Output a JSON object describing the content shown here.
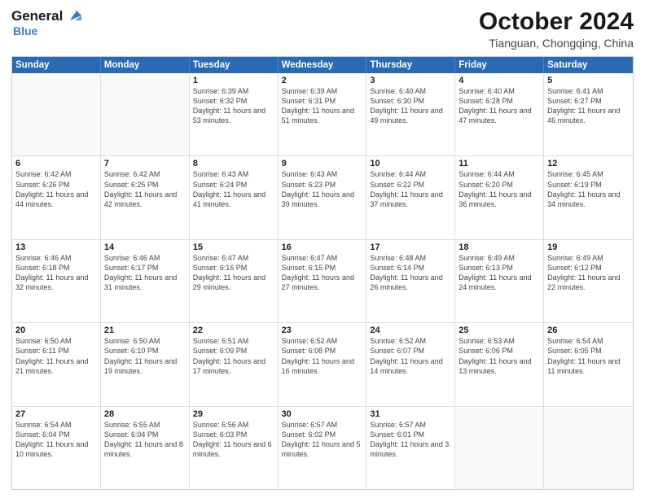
{
  "header": {
    "logo_general": "General",
    "logo_blue": "Blue",
    "main_title": "October 2024",
    "sub_title": "Tianguan, Chongqing, China"
  },
  "weekdays": [
    "Sunday",
    "Monday",
    "Tuesday",
    "Wednesday",
    "Thursday",
    "Friday",
    "Saturday"
  ],
  "weeks": [
    [
      {
        "day": "",
        "sunrise": "",
        "sunset": "",
        "daylight": "",
        "empty": true
      },
      {
        "day": "",
        "sunrise": "",
        "sunset": "",
        "daylight": "",
        "empty": true
      },
      {
        "day": "1",
        "sunrise": "Sunrise: 6:39 AM",
        "sunset": "Sunset: 6:32 PM",
        "daylight": "Daylight: 11 hours and 53 minutes.",
        "empty": false
      },
      {
        "day": "2",
        "sunrise": "Sunrise: 6:39 AM",
        "sunset": "Sunset: 6:31 PM",
        "daylight": "Daylight: 11 hours and 51 minutes.",
        "empty": false
      },
      {
        "day": "3",
        "sunrise": "Sunrise: 6:40 AM",
        "sunset": "Sunset: 6:30 PM",
        "daylight": "Daylight: 11 hours and 49 minutes.",
        "empty": false
      },
      {
        "day": "4",
        "sunrise": "Sunrise: 6:40 AM",
        "sunset": "Sunset: 6:28 PM",
        "daylight": "Daylight: 11 hours and 47 minutes.",
        "empty": false
      },
      {
        "day": "5",
        "sunrise": "Sunrise: 6:41 AM",
        "sunset": "Sunset: 6:27 PM",
        "daylight": "Daylight: 11 hours and 46 minutes.",
        "empty": false
      }
    ],
    [
      {
        "day": "6",
        "sunrise": "Sunrise: 6:42 AM",
        "sunset": "Sunset: 6:26 PM",
        "daylight": "Daylight: 11 hours and 44 minutes.",
        "empty": false
      },
      {
        "day": "7",
        "sunrise": "Sunrise: 6:42 AM",
        "sunset": "Sunset: 6:25 PM",
        "daylight": "Daylight: 11 hours and 42 minutes.",
        "empty": false
      },
      {
        "day": "8",
        "sunrise": "Sunrise: 6:43 AM",
        "sunset": "Sunset: 6:24 PM",
        "daylight": "Daylight: 11 hours and 41 minutes.",
        "empty": false
      },
      {
        "day": "9",
        "sunrise": "Sunrise: 6:43 AM",
        "sunset": "Sunset: 6:23 PM",
        "daylight": "Daylight: 11 hours and 39 minutes.",
        "empty": false
      },
      {
        "day": "10",
        "sunrise": "Sunrise: 6:44 AM",
        "sunset": "Sunset: 6:22 PM",
        "daylight": "Daylight: 11 hours and 37 minutes.",
        "empty": false
      },
      {
        "day": "11",
        "sunrise": "Sunrise: 6:44 AM",
        "sunset": "Sunset: 6:20 PM",
        "daylight": "Daylight: 11 hours and 36 minutes.",
        "empty": false
      },
      {
        "day": "12",
        "sunrise": "Sunrise: 6:45 AM",
        "sunset": "Sunset: 6:19 PM",
        "daylight": "Daylight: 11 hours and 34 minutes.",
        "empty": false
      }
    ],
    [
      {
        "day": "13",
        "sunrise": "Sunrise: 6:46 AM",
        "sunset": "Sunset: 6:18 PM",
        "daylight": "Daylight: 11 hours and 32 minutes.",
        "empty": false
      },
      {
        "day": "14",
        "sunrise": "Sunrise: 6:46 AM",
        "sunset": "Sunset: 6:17 PM",
        "daylight": "Daylight: 11 hours and 31 minutes.",
        "empty": false
      },
      {
        "day": "15",
        "sunrise": "Sunrise: 6:47 AM",
        "sunset": "Sunset: 6:16 PM",
        "daylight": "Daylight: 11 hours and 29 minutes.",
        "empty": false
      },
      {
        "day": "16",
        "sunrise": "Sunrise: 6:47 AM",
        "sunset": "Sunset: 6:15 PM",
        "daylight": "Daylight: 11 hours and 27 minutes.",
        "empty": false
      },
      {
        "day": "17",
        "sunrise": "Sunrise: 6:48 AM",
        "sunset": "Sunset: 6:14 PM",
        "daylight": "Daylight: 11 hours and 26 minutes.",
        "empty": false
      },
      {
        "day": "18",
        "sunrise": "Sunrise: 6:49 AM",
        "sunset": "Sunset: 6:13 PM",
        "daylight": "Daylight: 11 hours and 24 minutes.",
        "empty": false
      },
      {
        "day": "19",
        "sunrise": "Sunrise: 6:49 AM",
        "sunset": "Sunset: 6:12 PM",
        "daylight": "Daylight: 11 hours and 22 minutes.",
        "empty": false
      }
    ],
    [
      {
        "day": "20",
        "sunrise": "Sunrise: 6:50 AM",
        "sunset": "Sunset: 6:11 PM",
        "daylight": "Daylight: 11 hours and 21 minutes.",
        "empty": false
      },
      {
        "day": "21",
        "sunrise": "Sunrise: 6:50 AM",
        "sunset": "Sunset: 6:10 PM",
        "daylight": "Daylight: 11 hours and 19 minutes.",
        "empty": false
      },
      {
        "day": "22",
        "sunrise": "Sunrise: 6:51 AM",
        "sunset": "Sunset: 6:09 PM",
        "daylight": "Daylight: 11 hours and 17 minutes.",
        "empty": false
      },
      {
        "day": "23",
        "sunrise": "Sunrise: 6:52 AM",
        "sunset": "Sunset: 6:08 PM",
        "daylight": "Daylight: 11 hours and 16 minutes.",
        "empty": false
      },
      {
        "day": "24",
        "sunrise": "Sunrise: 6:52 AM",
        "sunset": "Sunset: 6:07 PM",
        "daylight": "Daylight: 11 hours and 14 minutes.",
        "empty": false
      },
      {
        "day": "25",
        "sunrise": "Sunrise: 6:53 AM",
        "sunset": "Sunset: 6:06 PM",
        "daylight": "Daylight: 11 hours and 13 minutes.",
        "empty": false
      },
      {
        "day": "26",
        "sunrise": "Sunrise: 6:54 AM",
        "sunset": "Sunset: 6:05 PM",
        "daylight": "Daylight: 11 hours and 11 minutes.",
        "empty": false
      }
    ],
    [
      {
        "day": "27",
        "sunrise": "Sunrise: 6:54 AM",
        "sunset": "Sunset: 6:04 PM",
        "daylight": "Daylight: 11 hours and 10 minutes.",
        "empty": false
      },
      {
        "day": "28",
        "sunrise": "Sunrise: 6:55 AM",
        "sunset": "Sunset: 6:04 PM",
        "daylight": "Daylight: 11 hours and 8 minutes.",
        "empty": false
      },
      {
        "day": "29",
        "sunrise": "Sunrise: 6:56 AM",
        "sunset": "Sunset: 6:03 PM",
        "daylight": "Daylight: 11 hours and 6 minutes.",
        "empty": false
      },
      {
        "day": "30",
        "sunrise": "Sunrise: 6:57 AM",
        "sunset": "Sunset: 6:02 PM",
        "daylight": "Daylight: 11 hours and 5 minutes.",
        "empty": false
      },
      {
        "day": "31",
        "sunrise": "Sunrise: 6:57 AM",
        "sunset": "Sunset: 6:01 PM",
        "daylight": "Daylight: 11 hours and 3 minutes.",
        "empty": false
      },
      {
        "day": "",
        "sunrise": "",
        "sunset": "",
        "daylight": "",
        "empty": true
      },
      {
        "day": "",
        "sunrise": "",
        "sunset": "",
        "daylight": "",
        "empty": true
      }
    ]
  ]
}
